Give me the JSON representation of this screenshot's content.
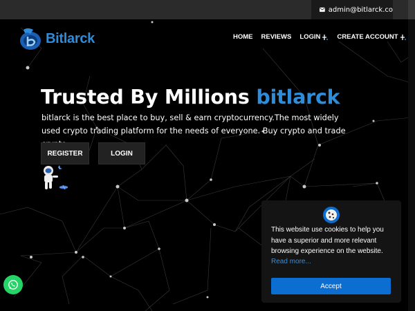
{
  "topbar": {
    "email": "admin@bitlarck.co",
    "email_icon": "envelope-icon"
  },
  "brand": {
    "name": "Bitlarck",
    "logo_icon": "bitlarck-logo-icon",
    "accent": "#2d8ddb"
  },
  "nav": {
    "items": [
      {
        "label": "HOME"
      },
      {
        "label": "REVIEWS"
      },
      {
        "label": "LOGIN",
        "icon": "sparkle-icon"
      },
      {
        "label": "CREATE ACCOUNT",
        "icon": "sparkle-icon"
      }
    ]
  },
  "hero": {
    "title_main": "Trusted By Millions ",
    "title_brand": "bitlarck",
    "description": "bitlarck is the best place to buy, sell & earn cryptocurrency.The most widely used crypto trading platform for the needs of everyone. Buy crypto and trade crypto.",
    "register_label": "REGISTER",
    "login_label": "LOGIN",
    "illustration": "astronaut-icon"
  },
  "cookie": {
    "icon": "cookie-icon",
    "text": "This website use cookies to help you have a superior and more relevant browsing experience on the website.",
    "link": "Read more...",
    "accept_label": "Accept",
    "accept_color": "#0d6ed2"
  },
  "whatsapp": {
    "icon": "whatsapp-icon",
    "color": "#25d366"
  }
}
